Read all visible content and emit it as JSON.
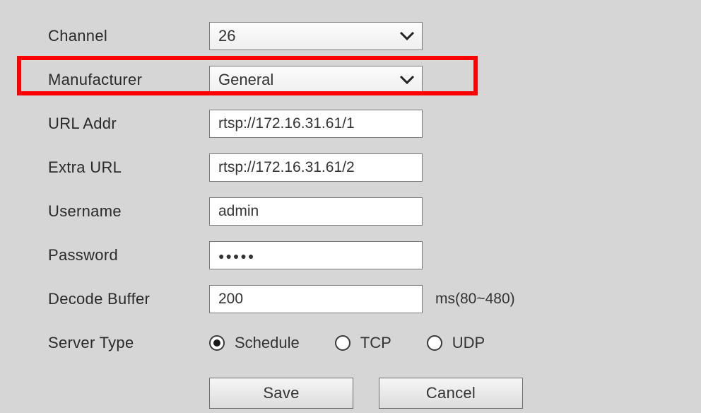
{
  "labels": {
    "channel": "Channel",
    "manufacturer": "Manufacturer",
    "url_addr": "URL Addr",
    "extra_url": "Extra URL",
    "username": "Username",
    "password": "Password",
    "decode_buffer": "Decode Buffer",
    "server_type": "Server Type"
  },
  "values": {
    "channel": "26",
    "manufacturer": "General",
    "url_addr": "rtsp://172.16.31.61/1",
    "extra_url": "rtsp://172.16.31.61/2",
    "username": "admin",
    "password": "●●●●●",
    "decode_buffer": "200"
  },
  "decode_buffer_hint": "ms(80~480)",
  "server_type_options": {
    "schedule": "Schedule",
    "tcp": "TCP",
    "udp": "UDP"
  },
  "server_type_selected": "schedule",
  "buttons": {
    "save": "Save",
    "cancel": "Cancel"
  }
}
